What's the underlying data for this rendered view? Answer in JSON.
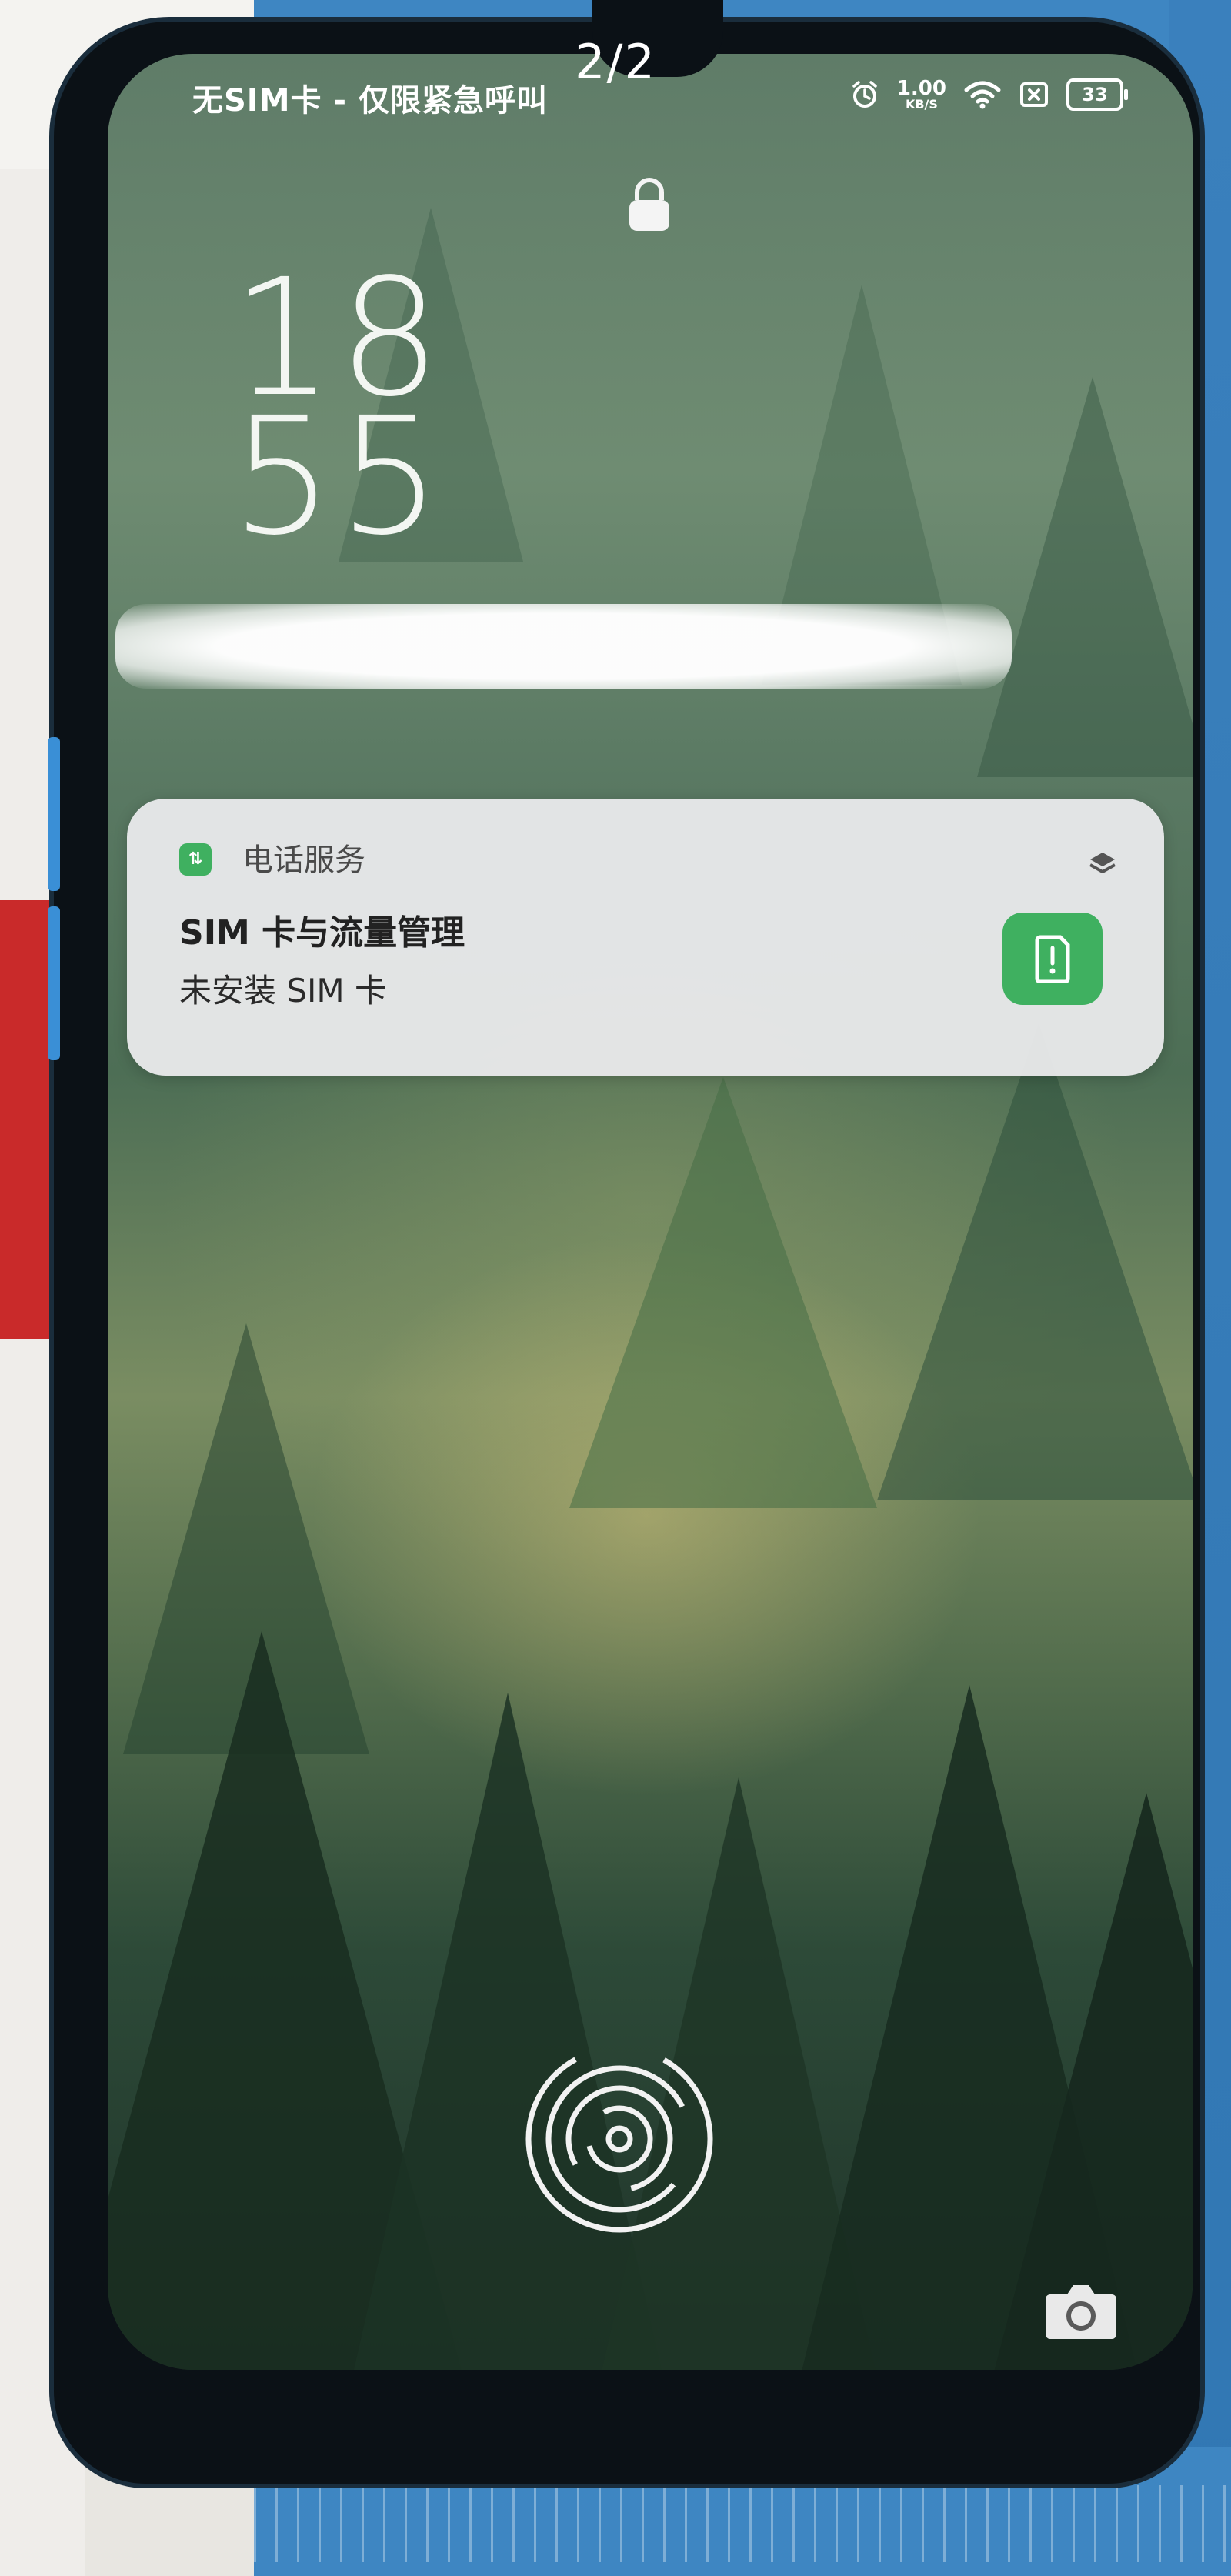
{
  "page_indicator": "2/2",
  "status_bar": {
    "carrier": "无SIM卡 - 仅限紧急呼叫",
    "net_speed_value": "1.00",
    "net_speed_unit": "KB/S",
    "battery": "33",
    "icons": [
      "alarm-icon",
      "wifi-icon",
      "no-sim-icon",
      "battery-icon"
    ]
  },
  "lock_icon": "lock-icon",
  "clock": {
    "hour": "18",
    "minute": "55"
  },
  "notification": {
    "app_name": "电话服务",
    "app_icon": "phone-service-icon",
    "title": "SIM 卡与流量管理",
    "text": "未安装 SIM 卡",
    "accent_color": "#3fb060"
  },
  "fingerprint_icon": "fingerprint-icon",
  "camera_icon": "camera-icon"
}
